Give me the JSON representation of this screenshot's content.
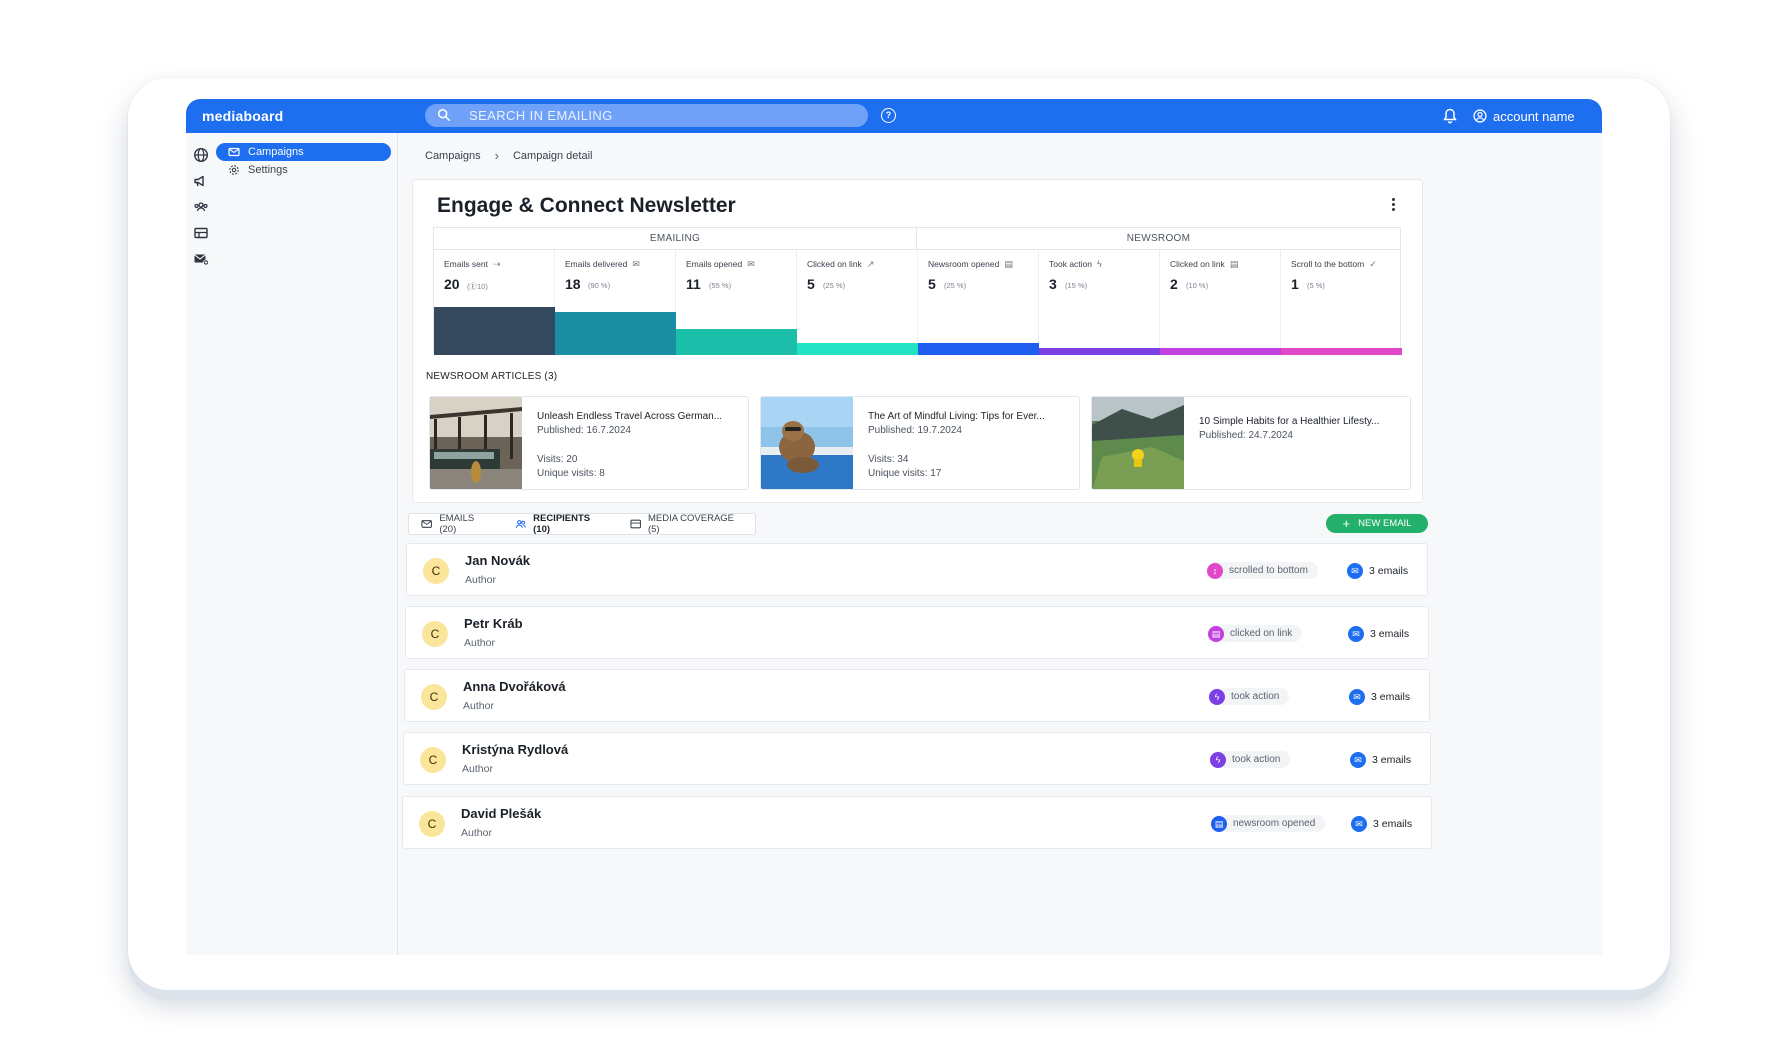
{
  "header": {
    "brand": "mediaboard",
    "search_placeholder": "SEARCH IN EMAILING",
    "account_name": "account name"
  },
  "subnav": {
    "items": [
      {
        "label": "Campaigns",
        "icon": "mail-icon",
        "active": true
      },
      {
        "label": "Settings",
        "icon": "gear-icon",
        "active": false
      }
    ]
  },
  "rail": {
    "icons": [
      "globe-icon",
      "megaphone-icon",
      "people-icon",
      "table-icon",
      "mail-add-icon"
    ]
  },
  "breadcrumb": [
    "Campaigns",
    "Campaign detail"
  ],
  "campaign": {
    "title": "Engage & Connect Newsletter",
    "groups": [
      "EMAILING",
      "NEWSROOM"
    ],
    "metrics": [
      {
        "label": "Emails sent",
        "value": "20",
        "detail": "(Ⓔ10)",
        "color": "#34495e",
        "level": 1.0
      },
      {
        "label": "Emails delivered",
        "value": "18",
        "detail": "(90 %)",
        "color": "#1a8fa3",
        "level": 0.9
      },
      {
        "label": "Emails opened",
        "value": "11",
        "detail": "(55 %)",
        "color": "#1bbfa9",
        "level": 0.55
      },
      {
        "label": "Clicked on link",
        "value": "5",
        "detail": "(25 %)",
        "color": "#24e3c4",
        "level": 0.25
      },
      {
        "label": "Newsroom opened",
        "value": "5",
        "detail": "(25 %)",
        "color": "#1e5fef",
        "level": 0.25
      },
      {
        "label": "Took action",
        "value": "3",
        "detail": "(15 %)",
        "color": "#7b3fe4",
        "level": 0.15
      },
      {
        "label": "Clicked on link",
        "value": "2",
        "detail": "(10 %)",
        "color": "#c23fe0",
        "level": 0.1
      },
      {
        "label": "Scroll to the bottom",
        "value": "1",
        "detail": "(5 %)",
        "color": "#e048c8",
        "level": 0.05
      }
    ],
    "articles_heading": "NEWSROOM ARTICLES (3)",
    "articles": [
      {
        "title": "Unleash Endless Travel Across German...",
        "published": "Published: 16.7.2024",
        "visits": "Visits: 20",
        "unique": "Unique visits: 8"
      },
      {
        "title": "The Art of Mindful Living: Tips for Ever...",
        "published": "Published: 19.7.2024",
        "visits": "Visits: 34",
        "unique": "Unique visits: 17"
      },
      {
        "title": "10 Simple Habits for a Healthier Lifesty...",
        "published": "Published: 24.7.2024",
        "visits": "",
        "unique": ""
      }
    ]
  },
  "tabs": [
    {
      "label": "EMAILS (20)",
      "icon": "mail-icon"
    },
    {
      "label": "RECIPIENTS (10)",
      "icon": "people-icon"
    },
    {
      "label": "MEDIA COVERAGE (5)",
      "icon": "newspaper-icon"
    }
  ],
  "new_email_label": "NEW EMAIL",
  "recipients": [
    {
      "initial": "C",
      "name": "Jan Novák",
      "role": "Author",
      "status": "scrolled to bottom",
      "status_color": "#e048c8",
      "emails": "3 emails"
    },
    {
      "initial": "C",
      "name": "Petr Kráb",
      "role": "Author",
      "status": "clicked on link",
      "status_color": "#c23fe0",
      "emails": "3 emails"
    },
    {
      "initial": "C",
      "name": "Anna Dvořáková",
      "role": "Author",
      "status": "took action",
      "status_color": "#7b3fe4",
      "emails": "3 emails"
    },
    {
      "initial": "C",
      "name": "Kristýna Rydlová",
      "role": "Author",
      "status": "took action",
      "status_color": "#7b3fe4",
      "emails": "3 emails"
    },
    {
      "initial": "C",
      "name": "David Plešák",
      "role": "Author",
      "status": "newsroom opened",
      "status_color": "#1e5fef",
      "emails": "3 emails"
    }
  ]
}
